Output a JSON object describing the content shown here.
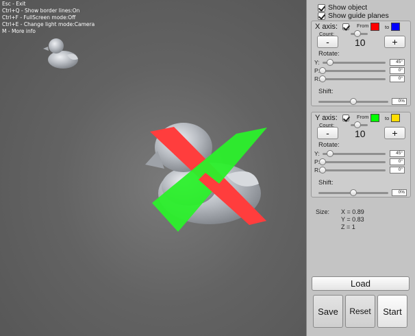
{
  "help": {
    "lines": [
      "Esc - Exit",
      "Ctrl+Q - Show border lines:On",
      "Ctrl+F - FullScreen mode:Off",
      "Ctrl+E - Change light mode:Camera",
      "M - More info"
    ]
  },
  "options": {
    "show_object": "Show object",
    "show_guide_planes": "Show guide planes",
    "show_object_checked": true,
    "show_guide_planes_checked": true
  },
  "x_axis": {
    "title": "X axis:",
    "checked": true,
    "from_label": "From",
    "to_label": "to",
    "from_color": "#ff0000",
    "to_color": "#0000ff",
    "count_label": "Count:",
    "count_value": "10",
    "count_slider": 0.4,
    "minus": "-",
    "plus": "+",
    "rotate_label": "Rotate:",
    "rot_y_label": "Y:",
    "rot_p_label": "P:",
    "rot_r_label": "R:",
    "rot_y_value": "45°",
    "rot_p_value": "0°",
    "rot_r_value": "0°",
    "rot_y_slider": 0.12,
    "rot_p_slider": 0.0,
    "rot_r_slider": 0.0,
    "shift_label": "Shift:",
    "shift_value": "0%",
    "shift_slider": 0.5
  },
  "y_axis": {
    "title": "Y axis:",
    "checked": true,
    "from_label": "From",
    "to_label": "to",
    "from_color": "#00ff00",
    "to_color": "#ffdd00",
    "count_label": "Count:",
    "count_value": "10",
    "count_slider": 0.4,
    "minus": "-",
    "plus": "+",
    "rotate_label": "Rotate:",
    "rot_y_label": "Y:",
    "rot_p_label": "P:",
    "rot_r_label": "R:",
    "rot_y_value": "45°",
    "rot_p_value": "0°",
    "rot_r_value": "0°",
    "rot_y_slider": 0.12,
    "rot_p_slider": 0.0,
    "rot_r_slider": 0.0,
    "shift_label": "Shift:",
    "shift_value": "0%",
    "shift_slider": 0.5
  },
  "size": {
    "label": "Size:",
    "x": "X = 0.89",
    "y": "Y = 0.83",
    "z": "Z = 1"
  },
  "buttons": {
    "load": "Load",
    "save": "Save",
    "reset": "Reset",
    "start": "Start"
  },
  "colors": {
    "red_plane": "#ff3b3b",
    "green_plane": "#22ee22",
    "duck": "#bfc3c8"
  }
}
